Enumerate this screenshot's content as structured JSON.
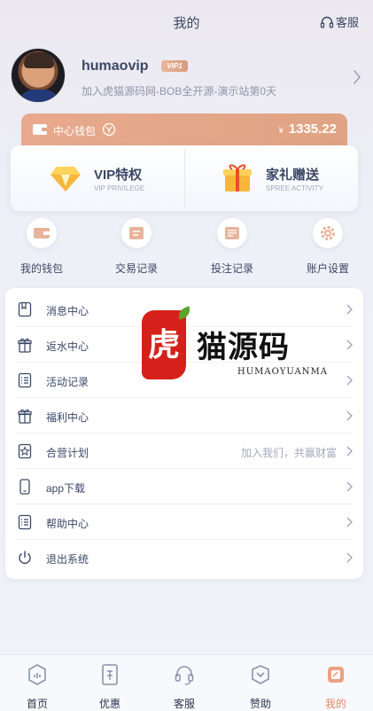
{
  "header": {
    "title": "我的",
    "service_label": "客服"
  },
  "profile": {
    "username": "humaovip",
    "vip_level": "VIP1",
    "join_info": "加入虎猫源码网-BOB全开源-演示站第0天"
  },
  "wallet": {
    "label": "中心钱包",
    "currency_symbol": "¥",
    "balance": "1335.22"
  },
  "vip_cards": [
    {
      "title": "VIP特权",
      "subtitle": "VIP PRIVILEGE",
      "icon": "diamond-icon"
    },
    {
      "title": "家礼赠送",
      "subtitle": "SPREE ACTIVITY",
      "icon": "gift-box-icon"
    }
  ],
  "quick_actions": [
    {
      "label": "我的钱包",
      "icon": "wallet-icon"
    },
    {
      "label": "交易记录",
      "icon": "receipt-icon"
    },
    {
      "label": "投注记录",
      "icon": "bet-record-icon"
    },
    {
      "label": "账户设置",
      "icon": "settings-gear-icon"
    }
  ],
  "menu": [
    {
      "label": "消息中心",
      "icon": "message-icon",
      "extra": ""
    },
    {
      "label": "返水中心",
      "icon": "gift-icon",
      "extra": ""
    },
    {
      "label": "活动记录",
      "icon": "list-icon",
      "extra": ""
    },
    {
      "label": "福利中心",
      "icon": "gift-icon",
      "extra": ""
    },
    {
      "label": "合营计划",
      "icon": "partner-icon",
      "extra": "加入我们，共赢财富"
    },
    {
      "label": "app下载",
      "icon": "phone-icon",
      "extra": ""
    },
    {
      "label": "帮助中心",
      "icon": "help-list-icon",
      "extra": ""
    },
    {
      "label": "退出系统",
      "icon": "power-icon",
      "extra": ""
    }
  ],
  "watermark": {
    "seal": "虎",
    "name": "猫源码",
    "latin": "HUMAOYUANMA"
  },
  "tabbar": [
    {
      "label": "首页",
      "icon": "home-icon",
      "active": false
    },
    {
      "label": "优惠",
      "icon": "coupon-icon",
      "active": false
    },
    {
      "label": "客服",
      "icon": "headset-icon",
      "active": false
    },
    {
      "label": "赞助",
      "icon": "sponsor-icon",
      "active": false
    },
    {
      "label": "我的",
      "icon": "profile-icon",
      "active": true
    }
  ],
  "colors": {
    "accent": "#e0a383",
    "text": "#3b4866",
    "muted": "#a3a9bb",
    "active_tab": "#e08b6a"
  }
}
